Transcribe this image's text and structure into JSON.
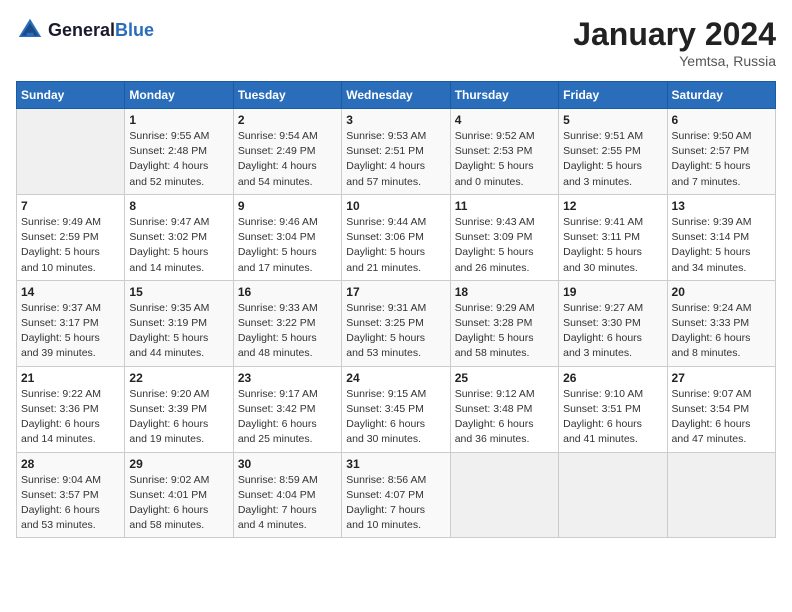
{
  "header": {
    "logo_general": "General",
    "logo_blue": "Blue",
    "month_title": "January 2024",
    "subtitle": "Yemtsa, Russia"
  },
  "days_of_week": [
    "Sunday",
    "Monday",
    "Tuesday",
    "Wednesday",
    "Thursday",
    "Friday",
    "Saturday"
  ],
  "weeks": [
    [
      {
        "day": "",
        "info": ""
      },
      {
        "day": "1",
        "info": "Sunrise: 9:55 AM\nSunset: 2:48 PM\nDaylight: 4 hours\nand 52 minutes."
      },
      {
        "day": "2",
        "info": "Sunrise: 9:54 AM\nSunset: 2:49 PM\nDaylight: 4 hours\nand 54 minutes."
      },
      {
        "day": "3",
        "info": "Sunrise: 9:53 AM\nSunset: 2:51 PM\nDaylight: 4 hours\nand 57 minutes."
      },
      {
        "day": "4",
        "info": "Sunrise: 9:52 AM\nSunset: 2:53 PM\nDaylight: 5 hours\nand 0 minutes."
      },
      {
        "day": "5",
        "info": "Sunrise: 9:51 AM\nSunset: 2:55 PM\nDaylight: 5 hours\nand 3 minutes."
      },
      {
        "day": "6",
        "info": "Sunrise: 9:50 AM\nSunset: 2:57 PM\nDaylight: 5 hours\nand 7 minutes."
      }
    ],
    [
      {
        "day": "7",
        "info": "Sunrise: 9:49 AM\nSunset: 2:59 PM\nDaylight: 5 hours\nand 10 minutes."
      },
      {
        "day": "8",
        "info": "Sunrise: 9:47 AM\nSunset: 3:02 PM\nDaylight: 5 hours\nand 14 minutes."
      },
      {
        "day": "9",
        "info": "Sunrise: 9:46 AM\nSunset: 3:04 PM\nDaylight: 5 hours\nand 17 minutes."
      },
      {
        "day": "10",
        "info": "Sunrise: 9:44 AM\nSunset: 3:06 PM\nDaylight: 5 hours\nand 21 minutes."
      },
      {
        "day": "11",
        "info": "Sunrise: 9:43 AM\nSunset: 3:09 PM\nDaylight: 5 hours\nand 26 minutes."
      },
      {
        "day": "12",
        "info": "Sunrise: 9:41 AM\nSunset: 3:11 PM\nDaylight: 5 hours\nand 30 minutes."
      },
      {
        "day": "13",
        "info": "Sunrise: 9:39 AM\nSunset: 3:14 PM\nDaylight: 5 hours\nand 34 minutes."
      }
    ],
    [
      {
        "day": "14",
        "info": "Sunrise: 9:37 AM\nSunset: 3:17 PM\nDaylight: 5 hours\nand 39 minutes."
      },
      {
        "day": "15",
        "info": "Sunrise: 9:35 AM\nSunset: 3:19 PM\nDaylight: 5 hours\nand 44 minutes."
      },
      {
        "day": "16",
        "info": "Sunrise: 9:33 AM\nSunset: 3:22 PM\nDaylight: 5 hours\nand 48 minutes."
      },
      {
        "day": "17",
        "info": "Sunrise: 9:31 AM\nSunset: 3:25 PM\nDaylight: 5 hours\nand 53 minutes."
      },
      {
        "day": "18",
        "info": "Sunrise: 9:29 AM\nSunset: 3:28 PM\nDaylight: 5 hours\nand 58 minutes."
      },
      {
        "day": "19",
        "info": "Sunrise: 9:27 AM\nSunset: 3:30 PM\nDaylight: 6 hours\nand 3 minutes."
      },
      {
        "day": "20",
        "info": "Sunrise: 9:24 AM\nSunset: 3:33 PM\nDaylight: 6 hours\nand 8 minutes."
      }
    ],
    [
      {
        "day": "21",
        "info": "Sunrise: 9:22 AM\nSunset: 3:36 PM\nDaylight: 6 hours\nand 14 minutes."
      },
      {
        "day": "22",
        "info": "Sunrise: 9:20 AM\nSunset: 3:39 PM\nDaylight: 6 hours\nand 19 minutes."
      },
      {
        "day": "23",
        "info": "Sunrise: 9:17 AM\nSunset: 3:42 PM\nDaylight: 6 hours\nand 25 minutes."
      },
      {
        "day": "24",
        "info": "Sunrise: 9:15 AM\nSunset: 3:45 PM\nDaylight: 6 hours\nand 30 minutes."
      },
      {
        "day": "25",
        "info": "Sunrise: 9:12 AM\nSunset: 3:48 PM\nDaylight: 6 hours\nand 36 minutes."
      },
      {
        "day": "26",
        "info": "Sunrise: 9:10 AM\nSunset: 3:51 PM\nDaylight: 6 hours\nand 41 minutes."
      },
      {
        "day": "27",
        "info": "Sunrise: 9:07 AM\nSunset: 3:54 PM\nDaylight: 6 hours\nand 47 minutes."
      }
    ],
    [
      {
        "day": "28",
        "info": "Sunrise: 9:04 AM\nSunset: 3:57 PM\nDaylight: 6 hours\nand 53 minutes."
      },
      {
        "day": "29",
        "info": "Sunrise: 9:02 AM\nSunset: 4:01 PM\nDaylight: 6 hours\nand 58 minutes."
      },
      {
        "day": "30",
        "info": "Sunrise: 8:59 AM\nSunset: 4:04 PM\nDaylight: 7 hours\nand 4 minutes."
      },
      {
        "day": "31",
        "info": "Sunrise: 8:56 AM\nSunset: 4:07 PM\nDaylight: 7 hours\nand 10 minutes."
      },
      {
        "day": "",
        "info": ""
      },
      {
        "day": "",
        "info": ""
      },
      {
        "day": "",
        "info": ""
      }
    ]
  ]
}
